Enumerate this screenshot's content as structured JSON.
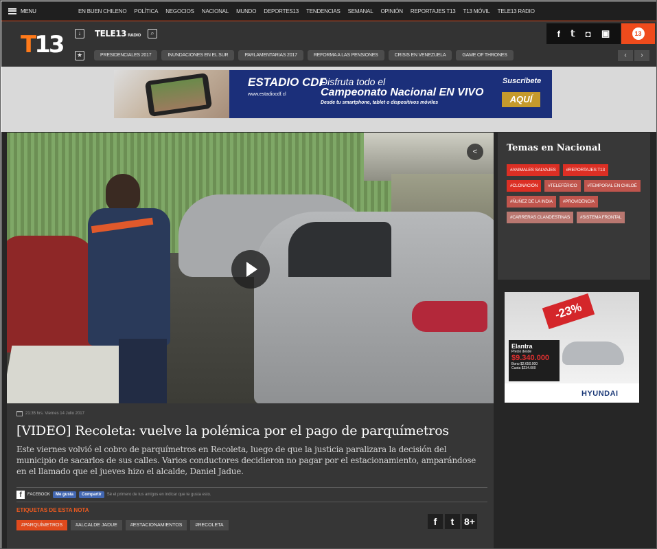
{
  "topnav": {
    "menu_label": "MENU",
    "links": [
      "EN BUEN CHILENO",
      "POLÍTICA",
      "NEGOCIOS",
      "NACIONAL",
      "MUNDO",
      "DEPORTES13",
      "TENDENCIAS",
      "SEMANAL",
      "OPINIÓN",
      "REPORTAJES T13",
      "T13 MÓVIL",
      "TELE13 RADIO"
    ]
  },
  "header": {
    "logo_t": "T",
    "logo_13": "13",
    "brand": "TELE13",
    "brand_sub": "RADIO",
    "social": [
      "f",
      "t",
      "ig",
      "yt"
    ],
    "profile": "13",
    "trending": [
      "PRESIDENCIALES 2017",
      "INUNDACIONES EN EL SUR",
      "PARLAMENTARIAS 2017",
      "REFORMA A LAS PENSIONES",
      "CRISIS EN VENEZUELA",
      "GAME OF THRONES"
    ],
    "arrow_prev": "‹",
    "arrow_next": "›"
  },
  "banner": {
    "estadio": "ESTADIO CDF",
    "estadio_url": "www.estadiocdf.cl",
    "line1": "Disfruta todo el",
    "line2": "Campeonato Nacional EN VIVO",
    "line3": "Desde tu smartphone, tablet o dispositivos móviles",
    "cta_top": "Suscríbete",
    "cta": "AQUÍ"
  },
  "article": {
    "datetime": "21:35 hrs. Viernes 14 Julio 2017",
    "title": "[VIDEO] Recoleta: vuelve la polémica por el pago de parquímetros",
    "summary": "Este viernes volvió el cobro de parquímetros en Recoleta, luego de que la justicia paralizara la decisión del municipio de sacarlos de sus calles. Varios conductores decidieron no pagar por el estacionamiento, amparándose en el llamado que el jueves hizo el alcalde, Daniel Jadue.",
    "facebook_label": "FACEBOOK",
    "like_label": "Me gusta",
    "share_label": "Compartir",
    "like_hint": "Sé el primero de tus amigos en indicar que te gusta esto.",
    "tags_title": "ETIQUETAS DE ESTA NOTA",
    "tags": [
      "#PARQUÍMETROS",
      "#ALCALDE JADUE",
      "#ESTACIONAMIENTOS",
      "#RECOLETA"
    ],
    "share_icons": [
      "f",
      "t",
      "8+"
    ]
  },
  "sidebar": {
    "title": "Temas en Nacional",
    "topics": [
      {
        "label": "#ANIMALES SALVAJES",
        "tone": "a"
      },
      {
        "label": "#REPORTAJES T13",
        "tone": "a"
      },
      {
        "label": "#CLONACIÓN",
        "tone": "a"
      },
      {
        "label": "#TELEFÉRICO",
        "tone": "b"
      },
      {
        "label": "#TEMPORAL EN CHILOÉ",
        "tone": "b"
      },
      {
        "label": "#ÑUÑEZ DE LA INDIA",
        "tone": "b"
      },
      {
        "label": "#PROVIDENCIA",
        "tone": "b"
      },
      {
        "label": "#CARRERAS CLANDESTINAS",
        "tone": "c"
      },
      {
        "label": "#SISTEMA FRONTAL",
        "tone": "c"
      }
    ]
  },
  "ad": {
    "discount": "-23%",
    "model": "Elantra",
    "price_label": "Precio desde",
    "price": "$9.340.000",
    "bono": "Bono $2.650.000",
    "cuota": "Cuota $234.000",
    "brand": "HYUNDAI"
  },
  "colors": {
    "accent": "#e04a1d",
    "dark_bg": "#262626",
    "panel": "#363636"
  }
}
